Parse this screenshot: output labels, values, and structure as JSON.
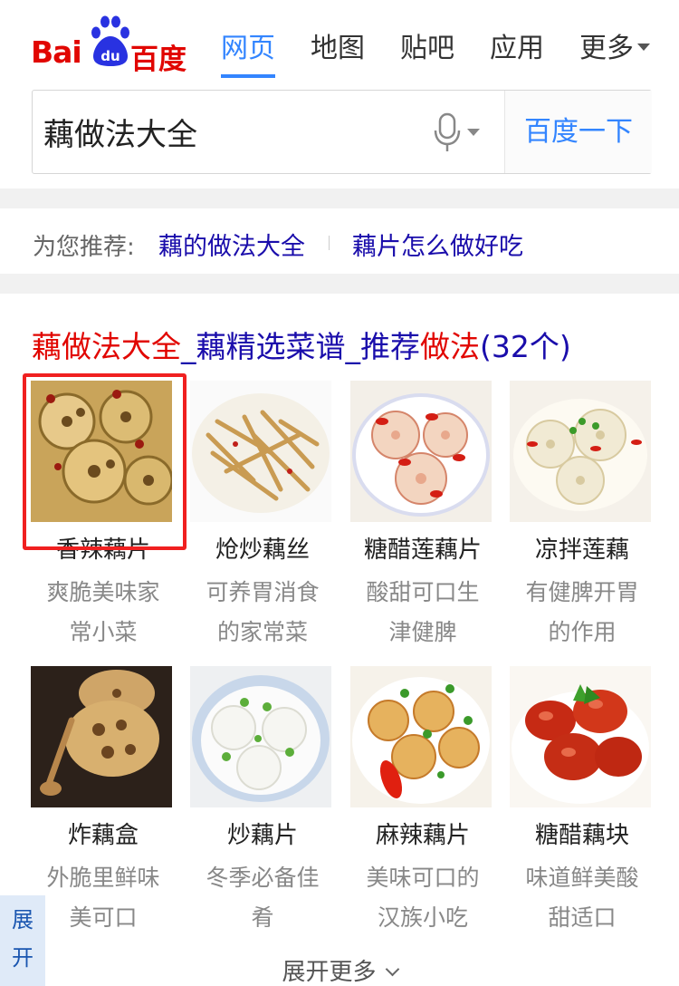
{
  "logo": {
    "latin": "Bai",
    "paw_text": "du",
    "chinese": "百度"
  },
  "nav": {
    "items": [
      {
        "label": "网页",
        "active": true
      },
      {
        "label": "地图",
        "active": false
      },
      {
        "label": "贴吧",
        "active": false
      },
      {
        "label": "应用",
        "active": false
      },
      {
        "label": "更多",
        "active": false,
        "dropdown": true
      }
    ]
  },
  "search": {
    "query": "藕做法大全",
    "mic_icon": "microphone-icon",
    "button_label": "百度一下"
  },
  "recommend": {
    "label": "为您推荐:",
    "links": [
      "藕的做法大全",
      "藕片怎么做好吃"
    ]
  },
  "result": {
    "title_parts": [
      {
        "text": "藕做法大全",
        "highlight": true
      },
      {
        "text": "_藕精选菜谱_推荐",
        "highlight": false
      },
      {
        "text": "做法",
        "highlight": true
      },
      {
        "text": "(32个)",
        "highlight": false
      }
    ],
    "recipes": [
      {
        "name": "香辣藕片",
        "desc1": "爽脆美味家",
        "desc2": "常小菜"
      },
      {
        "name": "炝炒藕丝",
        "desc1": "可养胃消食",
        "desc2": "的家常菜"
      },
      {
        "name": "糖醋莲藕片",
        "desc1": "酸甜可口生",
        "desc2": "津健脾"
      },
      {
        "name": "凉拌莲藕",
        "desc1": "有健脾开胃",
        "desc2": "的作用"
      },
      {
        "name": "炸藕盒",
        "desc1": "外脆里鲜味",
        "desc2": "美可口"
      },
      {
        "name": "炒藕片",
        "desc1": "冬季必备佳",
        "desc2": "肴"
      },
      {
        "name": "麻辣藕片",
        "desc1": "美味可口的",
        "desc2": "汉族小吃"
      },
      {
        "name": "糖醋藕块",
        "desc1": "味道鲜美酸",
        "desc2": "甜适口"
      }
    ],
    "expand_label": "展开更多"
  },
  "side_tab": {
    "line1": "展",
    "line2": "开"
  },
  "colors": {
    "brand_red": "#e10601",
    "link_blue": "#1a0dab",
    "accent_blue": "#3385ff",
    "highlight_box": "#f02020"
  }
}
